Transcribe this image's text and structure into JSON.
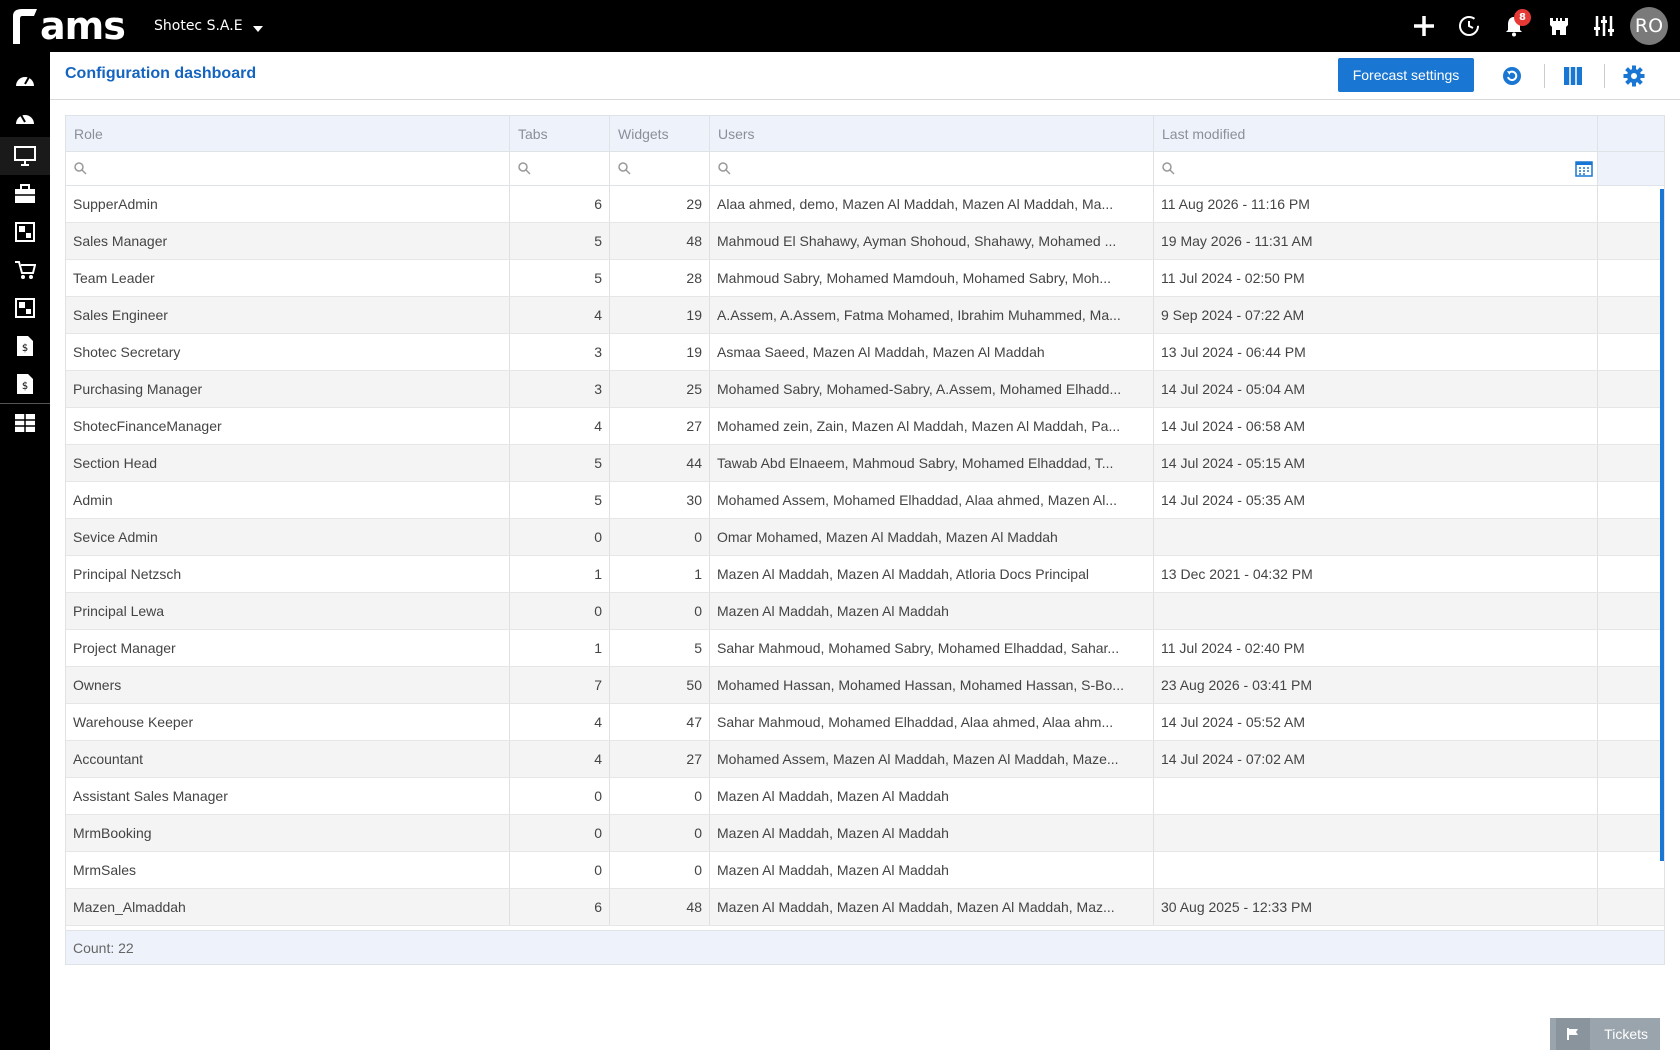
{
  "app": {
    "logo_text": "ams"
  },
  "topbar": {
    "company": "Shotec S.A.E",
    "notification_count": "8",
    "avatar_initials": "RO",
    "icons": [
      "plus-icon",
      "history-icon",
      "bell-icon",
      "castle-icon",
      "sliders-icon"
    ]
  },
  "sidebar": {
    "icons": [
      "dashboard-icon",
      "dashboard-alt-icon",
      "monitor-icon",
      "briefcase-icon",
      "modules-icon",
      "cart-icon",
      "modules-alt-icon",
      "invoice-icon",
      "invoice-alt-icon",
      "report-icon"
    ]
  },
  "header": {
    "title": "Configuration dashboard",
    "forecast_button": "Forecast settings"
  },
  "grid": {
    "columns": [
      "Role",
      "Tabs",
      "Widgets",
      "Users",
      "Last modified"
    ],
    "rows": [
      {
        "role": "SupperAdmin",
        "tabs": "6",
        "widgets": "29",
        "users": "Alaa ahmed, demo, Mazen Al Maddah, Mazen Al Maddah, Ma...",
        "modified": "11 Aug 2026 - 11:16 PM"
      },
      {
        "role": "Sales Manager",
        "tabs": "5",
        "widgets": "48",
        "users": "Mahmoud El Shahawy, Ayman Shohoud, Shahawy, Mohamed ...",
        "modified": "19 May 2026 - 11:31 AM"
      },
      {
        "role": "Team Leader",
        "tabs": "5",
        "widgets": "28",
        "users": "Mahmoud Sabry, Mohamed Mamdouh, Mohamed Sabry, Moh...",
        "modified": "11 Jul 2024 - 02:50 PM"
      },
      {
        "role": "Sales Engineer",
        "tabs": "4",
        "widgets": "19",
        "users": "A.Assem, A.Assem, Fatma Mohamed, Ibrahim Muhammed, Ma...",
        "modified": "9 Sep 2024 - 07:22 AM"
      },
      {
        "role": "Shotec Secretary",
        "tabs": "3",
        "widgets": "19",
        "users": "Asmaa Saeed, Mazen Al Maddah, Mazen Al Maddah",
        "modified": "13 Jul 2024 - 06:44 PM"
      },
      {
        "role": "Purchasing Manager",
        "tabs": "3",
        "widgets": "25",
        "users": "Mohamed Sabry, Mohamed-Sabry, A.Assem, Mohamed Elhadd...",
        "modified": "14 Jul 2024 - 05:04 AM"
      },
      {
        "role": "ShotecFinanceManager",
        "tabs": "4",
        "widgets": "27",
        "users": "Mohamed zein, Zain, Mazen Al Maddah, Mazen Al Maddah, Pa...",
        "modified": "14 Jul 2024 - 06:58 AM"
      },
      {
        "role": "Section Head",
        "tabs": "5",
        "widgets": "44",
        "users": "Tawab Abd Elnaeem, Mahmoud Sabry, Mohamed Elhaddad, T...",
        "modified": "14 Jul 2024 - 05:15 AM"
      },
      {
        "role": "Admin",
        "tabs": "5",
        "widgets": "30",
        "users": "Mohamed Assem, Mohamed Elhaddad, Alaa ahmed, Mazen Al...",
        "modified": "14 Jul 2024 - 05:35 AM"
      },
      {
        "role": "Sevice Admin",
        "tabs": "0",
        "widgets": "0",
        "users": "Omar Mohamed, Mazen Al Maddah, Mazen Al Maddah",
        "modified": ""
      },
      {
        "role": "Principal Netzsch",
        "tabs": "1",
        "widgets": "1",
        "users": "Mazen Al Maddah, Mazen Al Maddah, Atloria Docs Principal",
        "modified": "13 Dec 2021 - 04:32 PM"
      },
      {
        "role": "Principal Lewa",
        "tabs": "0",
        "widgets": "0",
        "users": "Mazen Al Maddah, Mazen Al Maddah",
        "modified": ""
      },
      {
        "role": "Project Manager",
        "tabs": "1",
        "widgets": "5",
        "users": "Sahar Mahmoud, Mohamed Sabry, Mohamed Elhaddad, Sahar...",
        "modified": "11 Jul 2024 - 02:40 PM"
      },
      {
        "role": "Owners",
        "tabs": "7",
        "widgets": "50",
        "users": "Mohamed Hassan, Mohamed Hassan, Mohamed Hassan, S-Bo...",
        "modified": "23 Aug 2026 - 03:41 PM"
      },
      {
        "role": "Warehouse Keeper",
        "tabs": "4",
        "widgets": "47",
        "users": "Sahar Mahmoud, Mohamed Elhaddad, Alaa ahmed, Alaa ahm...",
        "modified": "14 Jul 2024 - 05:52 AM"
      },
      {
        "role": "Accountant",
        "tabs": "4",
        "widgets": "27",
        "users": "Mohamed Assem, Mazen Al Maddah, Mazen Al Maddah, Maze...",
        "modified": "14 Jul 2024 - 07:02 AM"
      },
      {
        "role": "Assistant Sales Manager",
        "tabs": "0",
        "widgets": "0",
        "users": "Mazen Al Maddah, Mazen Al Maddah",
        "modified": ""
      },
      {
        "role": "MrmBooking",
        "tabs": "0",
        "widgets": "0",
        "users": "Mazen Al Maddah, Mazen Al Maddah",
        "modified": ""
      },
      {
        "role": "MrmSales",
        "tabs": "0",
        "widgets": "0",
        "users": "Mazen Al Maddah, Mazen Al Maddah",
        "modified": ""
      },
      {
        "role": "Mazen_Almaddah",
        "tabs": "6",
        "widgets": "48",
        "users": "Mazen Al Maddah, Mazen Al Maddah, Mazen Al Maddah, Maz...",
        "modified": "30 Aug 2025 - 12:33 PM"
      }
    ],
    "footer": "Count: 22"
  },
  "tickets": {
    "label": "Tickets"
  },
  "colors": {
    "accent": "#1976d2",
    "title": "#1565c0",
    "badge": "#e53935",
    "topbar": "#000000"
  }
}
